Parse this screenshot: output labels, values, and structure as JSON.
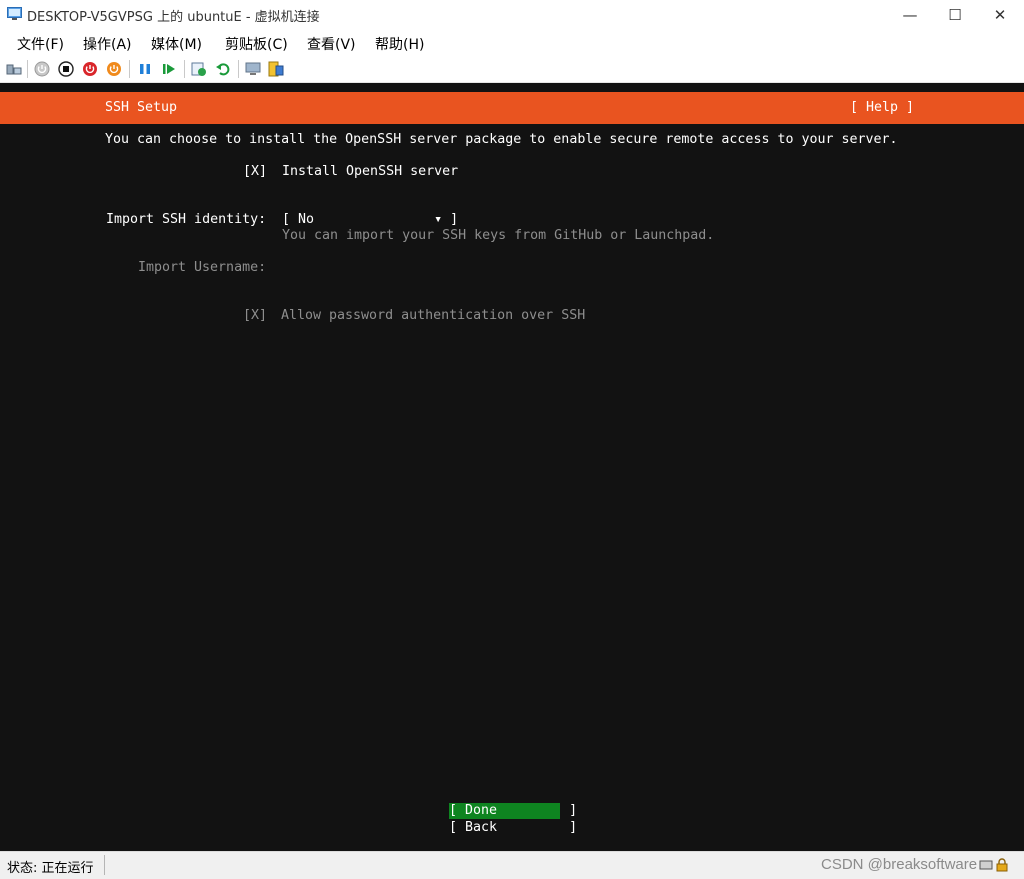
{
  "window": {
    "title": "DESKTOP-V5GVPSG 上的 ubuntuE - 虚拟机连接",
    "minimize_glyph": "—",
    "maximize_glyph": "☐",
    "close_glyph": "✕"
  },
  "menu": {
    "items": [
      "文件(F)",
      "操作(A)",
      "媒体(M)",
      "剪贴板(C)",
      "查看(V)",
      "帮助(H)"
    ]
  },
  "toolbar": {
    "icons": [
      "ctrl-alt-del-icon",
      "start-icon",
      "turn-off-icon",
      "shutdown-icon",
      "power-icon",
      "pause-icon",
      "resume-icon",
      "checkpoint-icon",
      "revert-icon",
      "enhanced-session-icon",
      "share-icon"
    ]
  },
  "console": {
    "header_title": "SSH Setup",
    "header_help": "[ Help ]",
    "intro": "You can choose to install the OpenSSH server package to enable secure remote access to your server.",
    "install_checkbox": "[X]",
    "install_label": "Install OpenSSH server",
    "import_label": "Import SSH identity:",
    "import_value": "[ No               ▾ ]",
    "import_hint": "You can import your SSH keys from GitHub or Launchpad.",
    "username_label": "Import Username:",
    "password_checkbox": "[X]",
    "password_label": "Allow password authentication over SSH",
    "done_button": "[ Done         ]",
    "back_button": "[ Back         ]"
  },
  "status": {
    "text": "状态: 正在运行",
    "watermark": "CSDN @breaksoftware"
  },
  "colors": {
    "header": "#e95420",
    "background": "#121212",
    "done": "#0e8420"
  }
}
